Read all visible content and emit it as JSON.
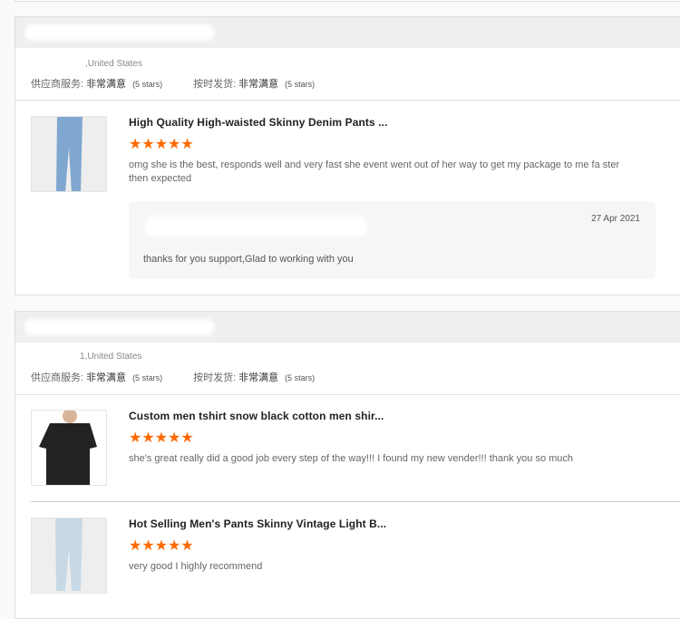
{
  "reviews": [
    {
      "location": ",United States",
      "supplier_service_label": "供应商服务:",
      "supplier_service_value": "非常满意",
      "supplier_service_stars": "(5 stars)",
      "ontime_label": "按时发货:",
      "ontime_value": "非常满意",
      "ontime_stars": "(5 stars)",
      "products": [
        {
          "title": "High Quality High-waisted Skinny Denim Pants ...",
          "rating": 5,
          "stars": "★★★★★",
          "text": "omg she is the best, responds well and very fast she event went out of her way to get my package to me fa ster then expected",
          "reply": {
            "date": "27 Apr 2021",
            "text": "thanks for you support,Glad to working with you"
          }
        }
      ]
    },
    {
      "location": "1,United States",
      "supplier_service_label": "供应商服务:",
      "supplier_service_value": "非常满意",
      "supplier_service_stars": "(5 stars)",
      "ontime_label": "按时发货:",
      "ontime_value": "非常满意",
      "ontime_stars": "(5 stars)",
      "products": [
        {
          "title": "Custom men tshirt snow black cotton men shir...",
          "rating": 5,
          "stars": "★★★★★",
          "text": "she's great really did a good job every step of the way!!! I found my new vender!!! thank you so much"
        },
        {
          "title": "Hot Selling Men's Pants Skinny Vintage Light B...",
          "rating": 5,
          "stars": "★★★★★",
          "text": "very good I highly recommend"
        }
      ]
    }
  ],
  "colors": {
    "star": "#ff6a00",
    "header": "#efefef"
  }
}
